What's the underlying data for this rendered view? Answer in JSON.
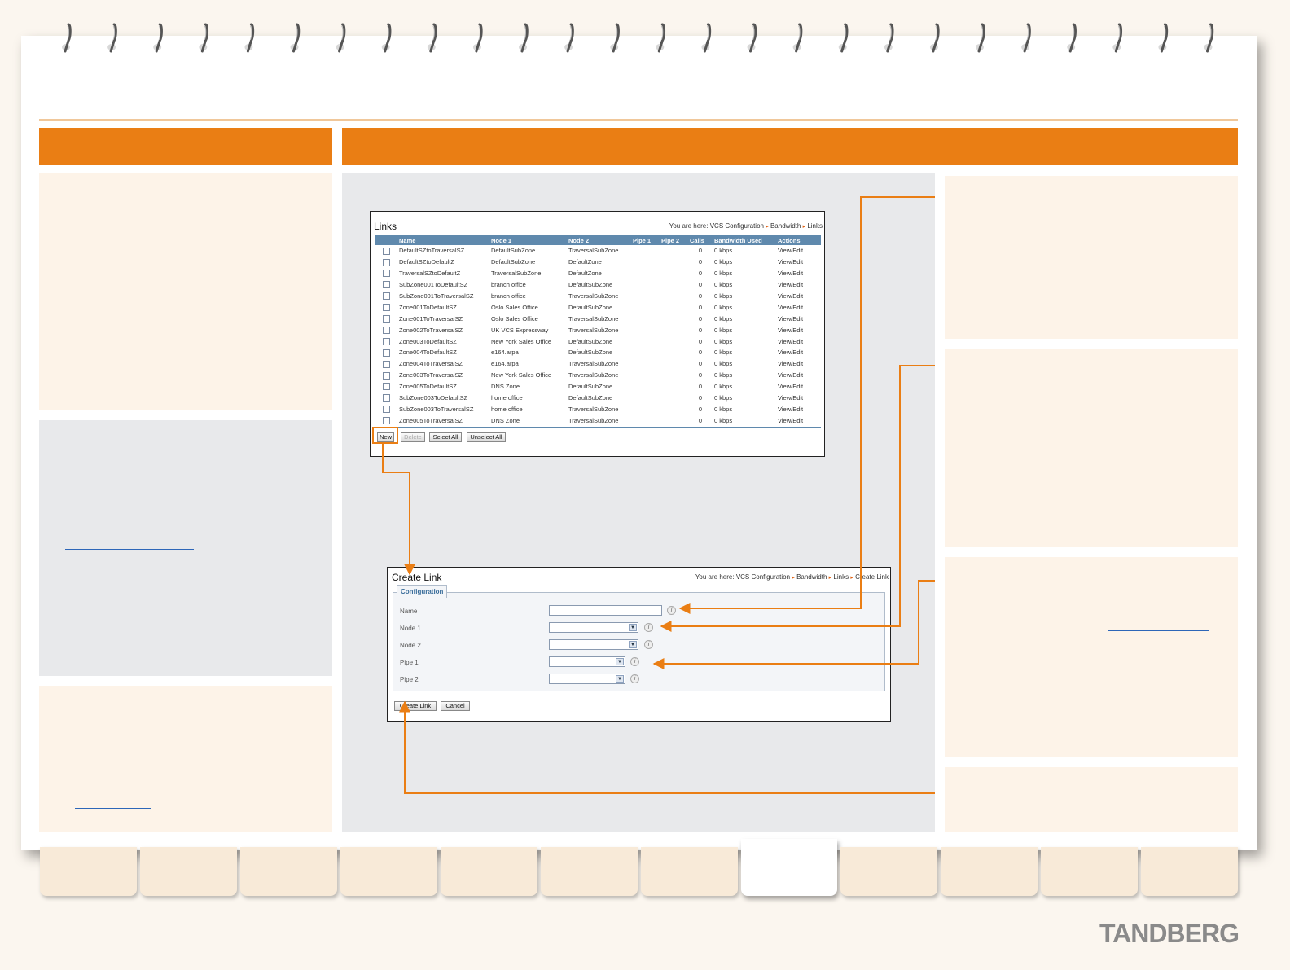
{
  "colors": {
    "accent": "#ea7e14",
    "cream_panel": "#fdf3e8",
    "grey_panel": "#e8e9eb",
    "header_row": "#5f89ad"
  },
  "brand": {
    "logo_text": "TANDBERG"
  },
  "links_window": {
    "title": "Links",
    "breadcrumb": {
      "prefix": "You are here:",
      "items": [
        "VCS Configuration",
        "Bandwidth",
        "Links"
      ]
    },
    "columns": [
      "Name",
      "Node 1",
      "Node 2",
      "Pipe 1",
      "Pipe 2",
      "Calls",
      "Bandwidth Used",
      "Actions"
    ],
    "rows": [
      [
        "DefaultSZtoTraversalSZ",
        "DefaultSubZone",
        "TraversalSubZone",
        "",
        "",
        "0",
        "0 kbps",
        "View/Edit"
      ],
      [
        "DefaultSZtoDefaultZ",
        "DefaultSubZone",
        "DefaultZone",
        "",
        "",
        "0",
        "0 kbps",
        "View/Edit"
      ],
      [
        "TraversalSZtoDefaultZ",
        "TraversalSubZone",
        "DefaultZone",
        "",
        "",
        "0",
        "0 kbps",
        "View/Edit"
      ],
      [
        "SubZone001ToDefaultSZ",
        "branch office",
        "DefaultSubZone",
        "",
        "",
        "0",
        "0 kbps",
        "View/Edit"
      ],
      [
        "SubZone001ToTraversalSZ",
        "branch office",
        "TraversalSubZone",
        "",
        "",
        "0",
        "0 kbps",
        "View/Edit"
      ],
      [
        "Zone001ToDefaultSZ",
        "Oslo Sales Office",
        "DefaultSubZone",
        "",
        "",
        "0",
        "0 kbps",
        "View/Edit"
      ],
      [
        "Zone001ToTraversalSZ",
        "Oslo Sales Office",
        "TraversalSubZone",
        "",
        "",
        "0",
        "0 kbps",
        "View/Edit"
      ],
      [
        "Zone002ToTraversalSZ",
        "UK VCS Expressway",
        "TraversalSubZone",
        "",
        "",
        "0",
        "0 kbps",
        "View/Edit"
      ],
      [
        "Zone003ToDefaultSZ",
        "New York Sales Office",
        "DefaultSubZone",
        "",
        "",
        "0",
        "0 kbps",
        "View/Edit"
      ],
      [
        "Zone004ToDefaultSZ",
        "e164.arpa",
        "DefaultSubZone",
        "",
        "",
        "0",
        "0 kbps",
        "View/Edit"
      ],
      [
        "Zone004ToTraversalSZ",
        "e164.arpa",
        "TraversalSubZone",
        "",
        "",
        "0",
        "0 kbps",
        "View/Edit"
      ],
      [
        "Zone003ToTraversalSZ",
        "New York Sales Office",
        "TraversalSubZone",
        "",
        "",
        "0",
        "0 kbps",
        "View/Edit"
      ],
      [
        "Zone005ToDefaultSZ",
        "DNS Zone",
        "DefaultSubZone",
        "",
        "",
        "0",
        "0 kbps",
        "View/Edit"
      ],
      [
        "SubZone003ToDefaultSZ",
        "home office",
        "DefaultSubZone",
        "",
        "",
        "0",
        "0 kbps",
        "View/Edit"
      ],
      [
        "SubZone003ToTraversalSZ",
        "home office",
        "TraversalSubZone",
        "",
        "",
        "0",
        "0 kbps",
        "View/Edit"
      ],
      [
        "Zone005ToTraversalSZ",
        "DNS Zone",
        "TraversalSubZone",
        "",
        "",
        "0",
        "0 kbps",
        "View/Edit"
      ]
    ],
    "buttons": {
      "new": "New",
      "delete": "Delete",
      "select_all": "Select All",
      "unselect_all": "Unselect All"
    }
  },
  "create_link_window": {
    "title": "Create Link",
    "breadcrumb": {
      "prefix": "You are here:",
      "items": [
        "VCS Configuration",
        "Bandwidth",
        "Links",
        "Create Link"
      ]
    },
    "section": "Configuration",
    "fields": {
      "name": "Name",
      "node1": "Node 1",
      "node2": "Node 2",
      "pipe1": "Pipe 1",
      "pipe2": "Pipe 2"
    },
    "values": {
      "name": "",
      "node1": "",
      "node2": "",
      "pipe1": "",
      "pipe2": ""
    },
    "buttons": {
      "create": "Create Link",
      "cancel": "Cancel"
    }
  },
  "icons": {
    "info": "info-icon",
    "dropdown": "chevron-down-icon",
    "breadcrumb_sep": "arrow-right-icon",
    "binder_ring": "binder-ring-icon"
  }
}
